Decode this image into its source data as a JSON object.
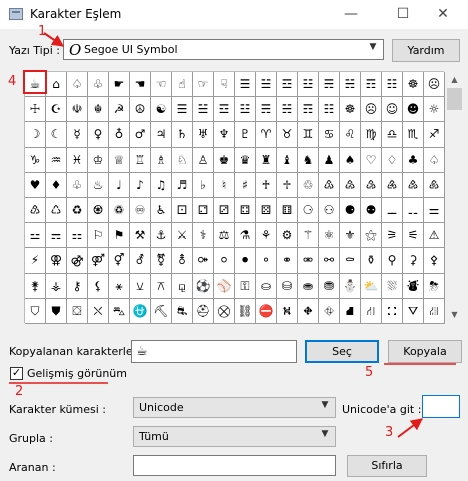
{
  "window": {
    "title": "Karakter Eşlem",
    "minimize": "—",
    "maximize": "☐",
    "close": "✕"
  },
  "font": {
    "label": "Yazı Tipi :",
    "selected": "Segoe UI Symbol",
    "font_icon": "O",
    "help_button": "Yardım"
  },
  "annotations": {
    "n1": "1",
    "n2": "2",
    "n3": "3",
    "n4": "4",
    "n5": "5",
    "color": "#e31b1b"
  },
  "grid": {
    "rows": [
      [
        "☕",
        "⌂",
        "♤",
        "♧",
        "☛",
        "☚",
        "☜",
        "☝",
        "☞",
        "☟",
        "☰",
        "☱",
        "☲",
        "☳",
        "☴",
        "☵",
        "☶",
        "☷",
        "☸",
        "☹"
      ],
      [
        "☩",
        "☪",
        "☫",
        "☬",
        "☭",
        "☮",
        "☯",
        "☰",
        "☱",
        "☲",
        "☳",
        "☴",
        "☵",
        "☶",
        "☷",
        "☸",
        "☹",
        "☺",
        "☻",
        "☼"
      ],
      [
        "☽",
        "☾",
        "☿",
        "♀",
        "♁",
        "♂",
        "♃",
        "♄",
        "♅",
        "♆",
        "♇",
        "♈",
        "♉",
        "♊",
        "♋",
        "♌",
        "♍",
        "♎",
        "♏",
        "♐"
      ],
      [
        "♑",
        "♒",
        "♓",
        "♔",
        "♕",
        "♖",
        "♗",
        "♘",
        "♙",
        "♚",
        "♛",
        "♜",
        "♝",
        "♞",
        "♟",
        "♠",
        "♡",
        "♢",
        "♣",
        "♤"
      ],
      [
        "♥",
        "♦",
        "♧",
        "♨",
        "♩",
        "♪",
        "♫",
        "♬",
        "♭",
        "♮",
        "♯",
        "♰",
        "♱",
        "♲",
        "♳",
        "♴",
        "♵",
        "♶",
        "♷",
        "♸"
      ],
      [
        "♹",
        "♺",
        "♻",
        "♼",
        "♽",
        "♾",
        "♿",
        "⚀",
        "⚁",
        "⚂",
        "⚃",
        "⚄",
        "⚅",
        "⚆",
        "⚇",
        "⚈",
        "⚉",
        "⚊",
        "⚋",
        "⚌"
      ],
      [
        "⚍",
        "⚎",
        "⚏",
        "⚐",
        "⚑",
        "⚒",
        "⚓",
        "⚔",
        "⚕",
        "⚖",
        "⚗",
        "⚘",
        "⚙",
        "⚚",
        "⚛",
        "⚜",
        "⚝",
        "⚞",
        "⚟",
        "⚠"
      ],
      [
        "⚡",
        "⚢",
        "⚣",
        "⚤",
        "⚥",
        "⚦",
        "⚧",
        "⚨",
        "⚩",
        "⚪",
        "⚫",
        "⚬",
        "⚭",
        "⚮",
        "⚯",
        "⚰",
        "⚱",
        "⚲",
        "⚳",
        "⚴"
      ],
      [
        "⚵",
        "⚶",
        "⚷",
        "⚸",
        "⚹",
        "⚺",
        "⚻",
        "⚼",
        "⚽",
        "⚾",
        "⚿",
        "⛀",
        "⛁",
        "⛂",
        "⛃",
        "⛄",
        "⛅",
        "⛆",
        "⛇",
        "⛈"
      ],
      [
        "⛉",
        "⛊",
        "⛋",
        "⛌",
        "⛍",
        "⛎",
        "⛏",
        "⛐",
        "⛑",
        "⛒",
        "⛓",
        "⛔",
        "⛕",
        "⛖",
        "⛗",
        "⛘",
        "⛙",
        "⛚",
        "⛛",
        "⛜"
      ]
    ]
  },
  "copy": {
    "label": "Kopyalanan karakterler :",
    "value": "☕",
    "select_button": "Seç",
    "copy_button": "Kopyala"
  },
  "advanced": {
    "checkbox_label": "Gelişmiş görünüm",
    "checked_mark": "✓",
    "charset_label": "Karakter kümesi :",
    "charset_value": "Unicode",
    "goto_label": "Unicode'a git :",
    "goto_value": "",
    "group_label": "Grupla :",
    "group_value": "Tümü",
    "search_label": "Aranan :",
    "search_value": "",
    "clear_button": "Sıfırla"
  }
}
